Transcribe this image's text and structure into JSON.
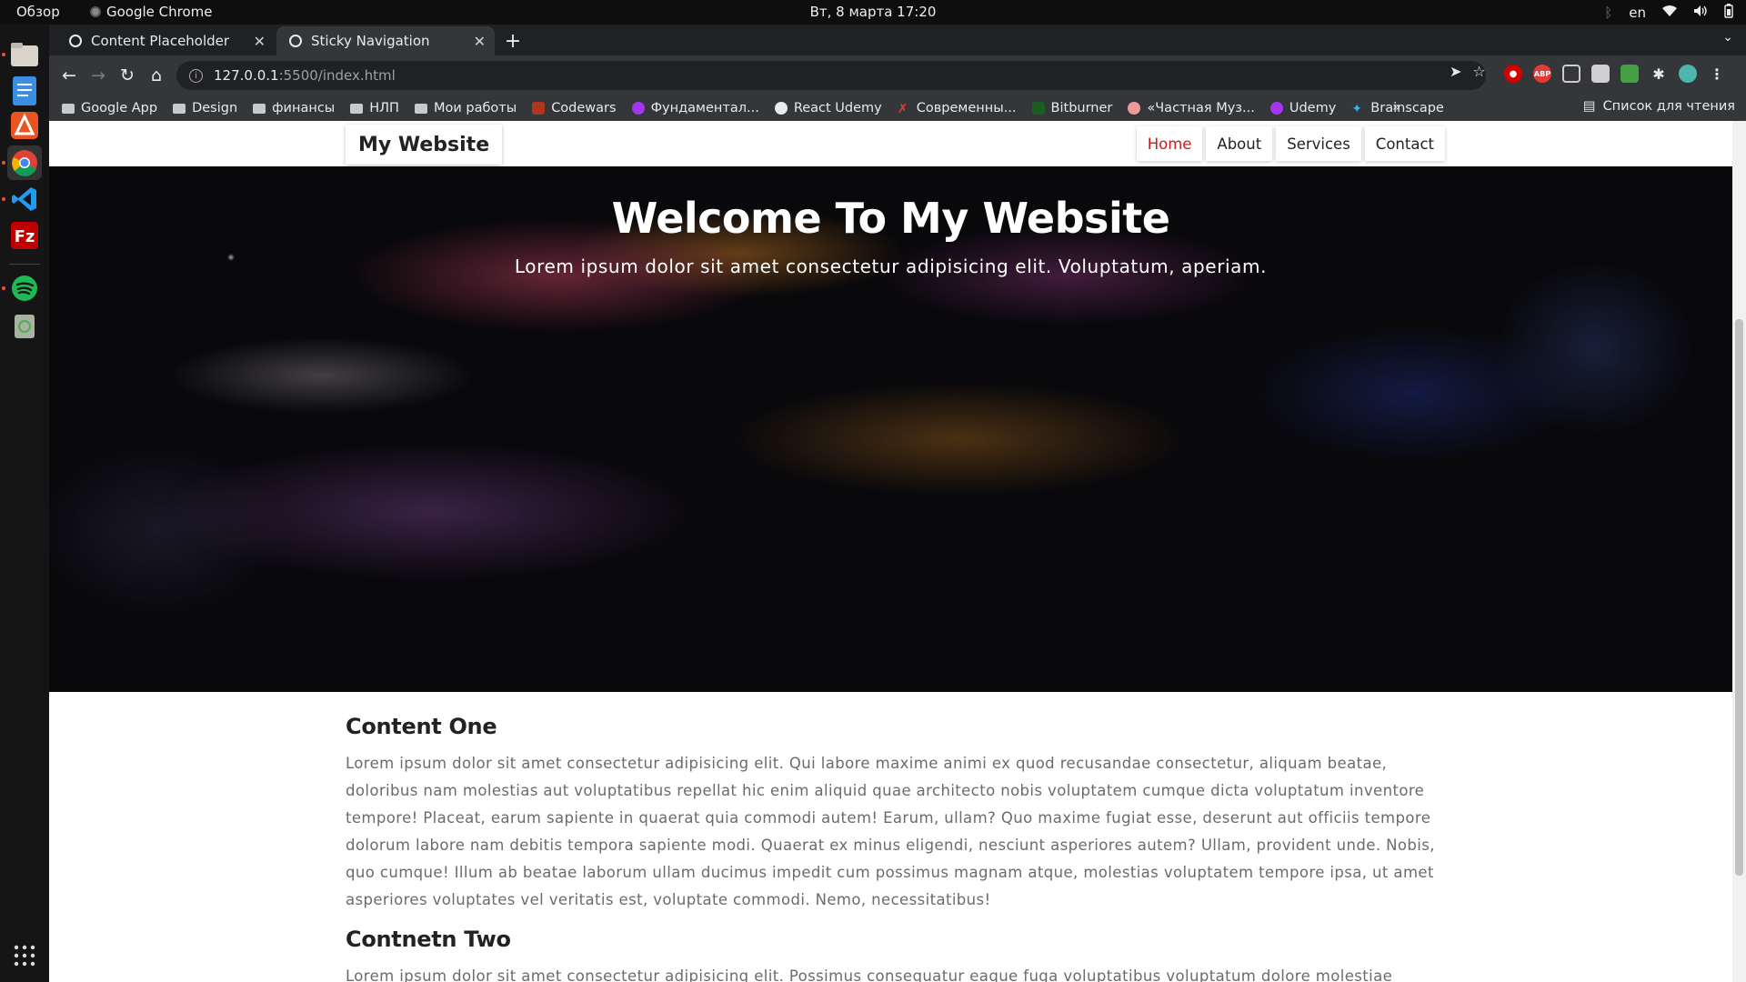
{
  "os": {
    "overview_label": "Обзор",
    "active_app": "Google Chrome",
    "clock": "Вт, 8 марта  17:20",
    "lang": "en"
  },
  "dock": {
    "items": [
      "files-icon",
      "text-editor-icon",
      "software-store-icon",
      "chrome-icon",
      "vscode-icon",
      "filezilla-icon",
      "spotify-icon",
      "trash-icon",
      "show-apps-icon"
    ]
  },
  "browser": {
    "tabs": [
      {
        "title": "Content Placeholder",
        "active": false
      },
      {
        "title": "Sticky Navigation",
        "active": true
      }
    ],
    "url_host": "127.0.0.1",
    "url_path": ":5500/index.html",
    "bookmarks": [
      {
        "label": "Google App",
        "type": "folder"
      },
      {
        "label": "Design",
        "type": "folder"
      },
      {
        "label": "финансы",
        "type": "folder"
      },
      {
        "label": "НЛП",
        "type": "folder"
      },
      {
        "label": "Мои работы",
        "type": "folder"
      },
      {
        "label": "Codewars",
        "type": "site",
        "color": "#b1361e"
      },
      {
        "label": "Фундаментал...",
        "type": "site",
        "color": "#a435f0"
      },
      {
        "label": "React Udemy",
        "type": "site",
        "color": "#e8eaed"
      },
      {
        "label": "Современны...",
        "type": "site",
        "color": "#e53935"
      },
      {
        "label": "Bitburner",
        "type": "site",
        "color": "#1b5e20"
      },
      {
        "label": "«Частная Муз...",
        "type": "site",
        "color": "#ef9a9a"
      },
      {
        "label": "Udemy",
        "type": "site",
        "color": "#a435f0"
      },
      {
        "label": "Brainscape",
        "type": "site",
        "color": "#29b6f6"
      }
    ],
    "bookmarks_more": "»",
    "reading_list": "Список для чтения"
  },
  "site": {
    "logo": "My Website",
    "menu": [
      {
        "label": "Home",
        "current": true
      },
      {
        "label": "About",
        "current": false
      },
      {
        "label": "Services",
        "current": false
      },
      {
        "label": "Contact",
        "current": false
      }
    ],
    "hero_title": "Welcome To My Website",
    "hero_subtitle": "Lorem ipsum dolor sit amet consectetur adipisicing elit. Voluptatum, aperiam.",
    "sections": [
      {
        "heading": "Content One",
        "body": "Lorem ipsum dolor sit amet consectetur adipisicing elit. Qui labore maxime animi ex quod recusandae consectetur, aliquam beatae, doloribus nam molestias aut voluptatibus repellat hic enim aliquid quae architecto nobis voluptatem cumque dicta voluptatum inventore tempore! Placeat, earum sapiente in quaerat quia commodi autem! Earum, ullam? Quo maxime fugiat esse, deserunt aut officiis tempore dolorum labore nam debitis tempora sapiente modi. Quaerat ex minus eligendi, nesciunt asperiores autem? Ullam, provident unde. Nobis, quo cumque! Illum ab beatae laborum ullam ducimus impedit cum possimus magnam atque, molestias voluptatem tempore ipsa, ut amet asperiores voluptates vel veritatis est, voluptate commodi. Nemo, necessitatibus!"
      },
      {
        "heading": "Contnetn Two",
        "body": "Lorem ipsum dolor sit amet consectetur adipisicing elit. Possimus consequatur eaque fuga voluptatibus voluptatum dolore molestiae"
      }
    ]
  }
}
